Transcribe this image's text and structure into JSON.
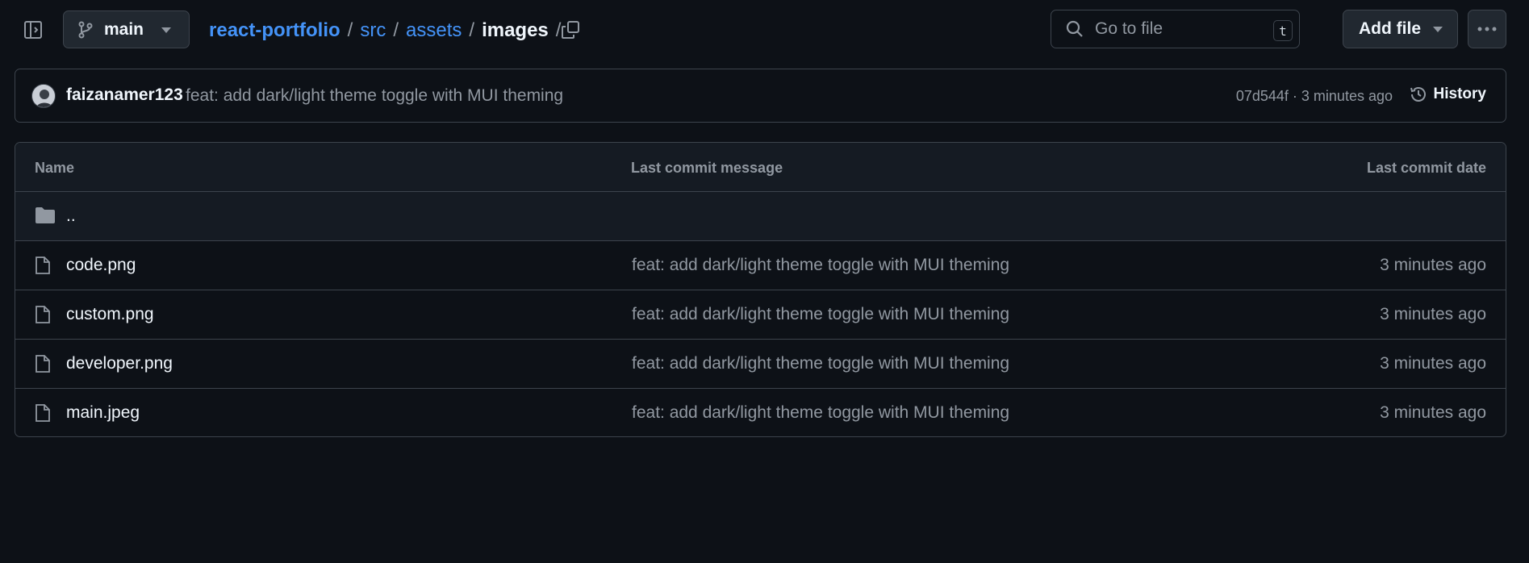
{
  "header": {
    "branch": "main",
    "breadcrumb": {
      "root": "react-portfolio",
      "segments": [
        "src",
        "assets"
      ],
      "current": "images",
      "separator": "/"
    },
    "search_placeholder": "Go to file",
    "search_shortcut": "t",
    "add_file_label": "Add file"
  },
  "commit": {
    "author": "faizanamer123",
    "message": "feat: add dark/light theme toggle with MUI theming",
    "meta": "07d544f · 3 minutes ago",
    "history_label": "History"
  },
  "table": {
    "columns": [
      "Name",
      "Last commit message",
      "Last commit date"
    ],
    "parent_label": "..",
    "rows": [
      {
        "name": "code.png",
        "message": "feat: add dark/light theme toggle with MUI theming",
        "date": "3 minutes ago"
      },
      {
        "name": "custom.png",
        "message": "feat: add dark/light theme toggle with MUI theming",
        "date": "3 minutes ago"
      },
      {
        "name": "developer.png",
        "message": "feat: add dark/light theme toggle with MUI theming",
        "date": "3 minutes ago"
      },
      {
        "name": "main.jpeg",
        "message": "feat: add dark/light theme toggle with MUI theming",
        "date": "3 minutes ago"
      }
    ]
  },
  "colors": {
    "background": "#0d1117",
    "link": "#4493f8",
    "muted": "#9198a1",
    "border": "#3d444d",
    "button_bg": "#212830"
  },
  "icons": [
    "sidebar-toggle-icon",
    "git-branch-icon",
    "chevron-down-icon",
    "copy-icon",
    "search-icon",
    "kebab-horizontal-icon",
    "history-icon",
    "folder-icon",
    "file-icon"
  ]
}
